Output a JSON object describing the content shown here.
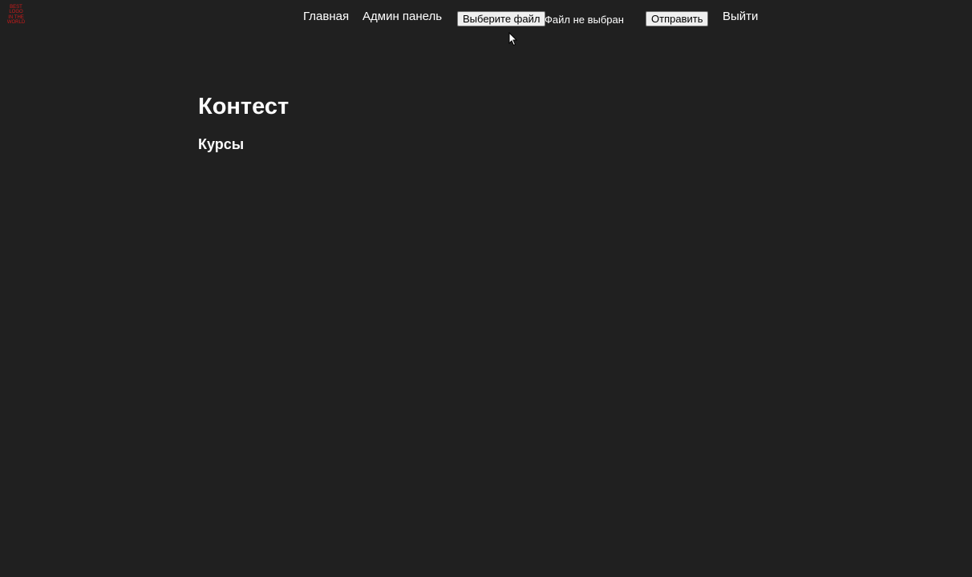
{
  "header": {
    "logo": {
      "lines": [
        "BEST",
        "LOGO",
        "IN THE",
        "WORLD"
      ],
      "color": "#cc1a1a"
    },
    "nav": {
      "home_label": "Главная",
      "admin_label": "Админ панель",
      "logout_label": "Выйти"
    },
    "upload": {
      "choose_file_label": "Выберите файл",
      "file_status": "Файл не выбран",
      "submit_label": "Отправить"
    }
  },
  "main": {
    "title": "Контест",
    "section_title": "Курсы"
  },
  "colors": {
    "background": "#202020",
    "text": "#ffffff"
  }
}
